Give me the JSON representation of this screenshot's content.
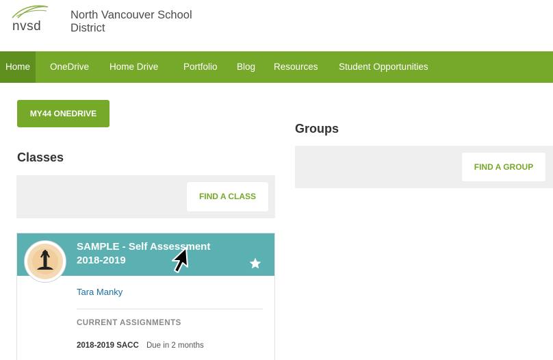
{
  "header": {
    "logo_text": "nvsd",
    "district_line1": "North Vancouver School",
    "district_line2": "District"
  },
  "nav": {
    "items": [
      {
        "label": "Home",
        "active": true
      },
      {
        "label": "OneDrive"
      },
      {
        "label": "Home Drive"
      },
      {
        "label": "Portfolio"
      },
      {
        "label": "Blog"
      },
      {
        "label": "Resources"
      },
      {
        "label": "Student Opportunities"
      }
    ]
  },
  "onedrive_button": "MY44 ONEDRIVE",
  "classes": {
    "heading": "Classes",
    "find_button": "FIND A CLASS",
    "card": {
      "title_line1": "SAMPLE - Self Assessment",
      "title_line2": "2018-2019",
      "teacher": "Tara Manky",
      "assignments_label": "CURRENT ASSIGNMENTS",
      "assignment": {
        "name": "2018-2019 SACC",
        "due": "Due in 2 months"
      }
    }
  },
  "groups": {
    "heading": "Groups",
    "find_button": "FIND A GROUP"
  },
  "colors": {
    "nav_green": "#76a92a",
    "nav_active": "#5f8f1f",
    "card_teal": "#5bb1b1",
    "link_blue": "#1a6fa0",
    "panel_gray": "#efefef"
  },
  "icons": {
    "logo": "leaf-swoosh-icon",
    "avatar": "meditation-icon",
    "favorite": "star-icon",
    "pointer": "mouse-cursor-icon"
  }
}
